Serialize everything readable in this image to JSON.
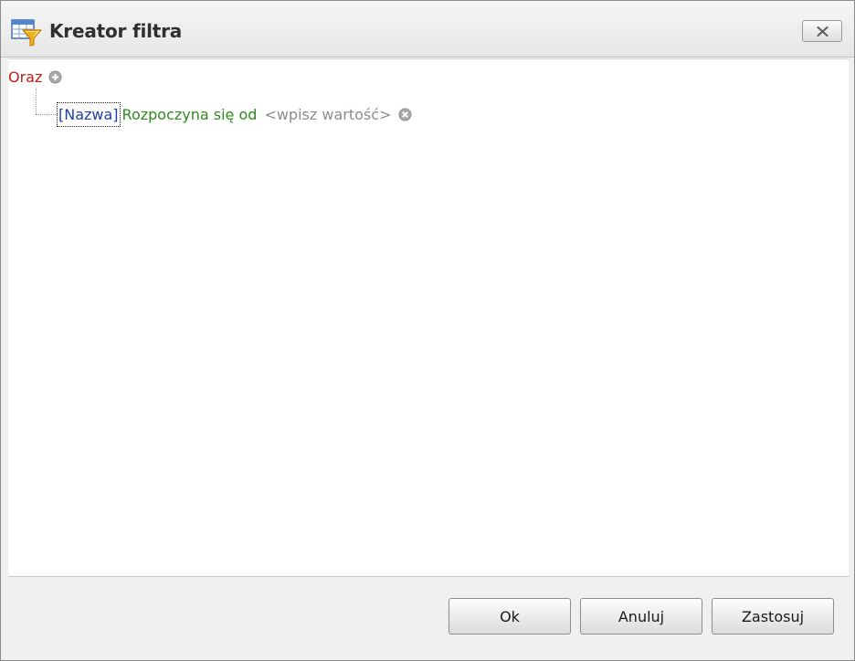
{
  "dialog": {
    "title": "Kreator filtra",
    "icon": "filter-table-icon",
    "close_icon": "close-icon"
  },
  "filter": {
    "group_operator": "Oraz",
    "add_icon": "plus-circle-icon",
    "condition": {
      "field": "[Nazwa]",
      "operator": "Rozpoczyna się od",
      "value": "<wpisz wartość>",
      "remove_icon": "remove-circle-icon"
    }
  },
  "buttons": {
    "ok": "Ok",
    "cancel": "Anuluj",
    "apply": "Zastosuj"
  },
  "colors": {
    "group_operator": "#c41a1a",
    "field": "#1f3fa8",
    "operator": "#2e8a1e",
    "value_placeholder": "#8c8c8c"
  }
}
